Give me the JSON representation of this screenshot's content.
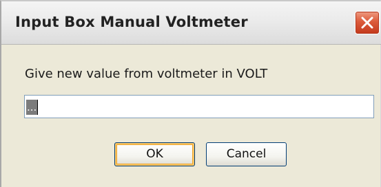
{
  "window": {
    "title": "Input Box Manual Voltmeter"
  },
  "dialog": {
    "prompt": "Give new value from voltmeter in VOLT",
    "input_value": "...",
    "ok_label": "OK",
    "cancel_label": "Cancel"
  },
  "icons": {
    "close": "close-icon"
  },
  "colors": {
    "close_button": "#d2502f",
    "default_button_focus": "#f0a52a",
    "dialog_background": "#ece9d8"
  }
}
